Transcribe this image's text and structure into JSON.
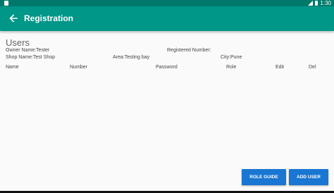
{
  "status_bar": {
    "time": "1:30"
  },
  "app_bar": {
    "title": "Registration"
  },
  "users_heading": "Users",
  "info": {
    "owner_name": "Owner Name:Tester",
    "registered_number": "Registered Number:",
    "shop_name": "Shop Name:Test Shop",
    "area": "Area:Testing bay",
    "city": "City:Pune"
  },
  "table": {
    "columns": [
      "Name",
      "Number",
      "Password",
      "Role",
      "Edit",
      "Del"
    ]
  },
  "buttons": {
    "role_guide": "ROLE GUIDE",
    "add_user": "ADD USER"
  },
  "colors": {
    "status_bar": "#00796b",
    "app_bar": "#009688",
    "button": "#1976d2"
  }
}
